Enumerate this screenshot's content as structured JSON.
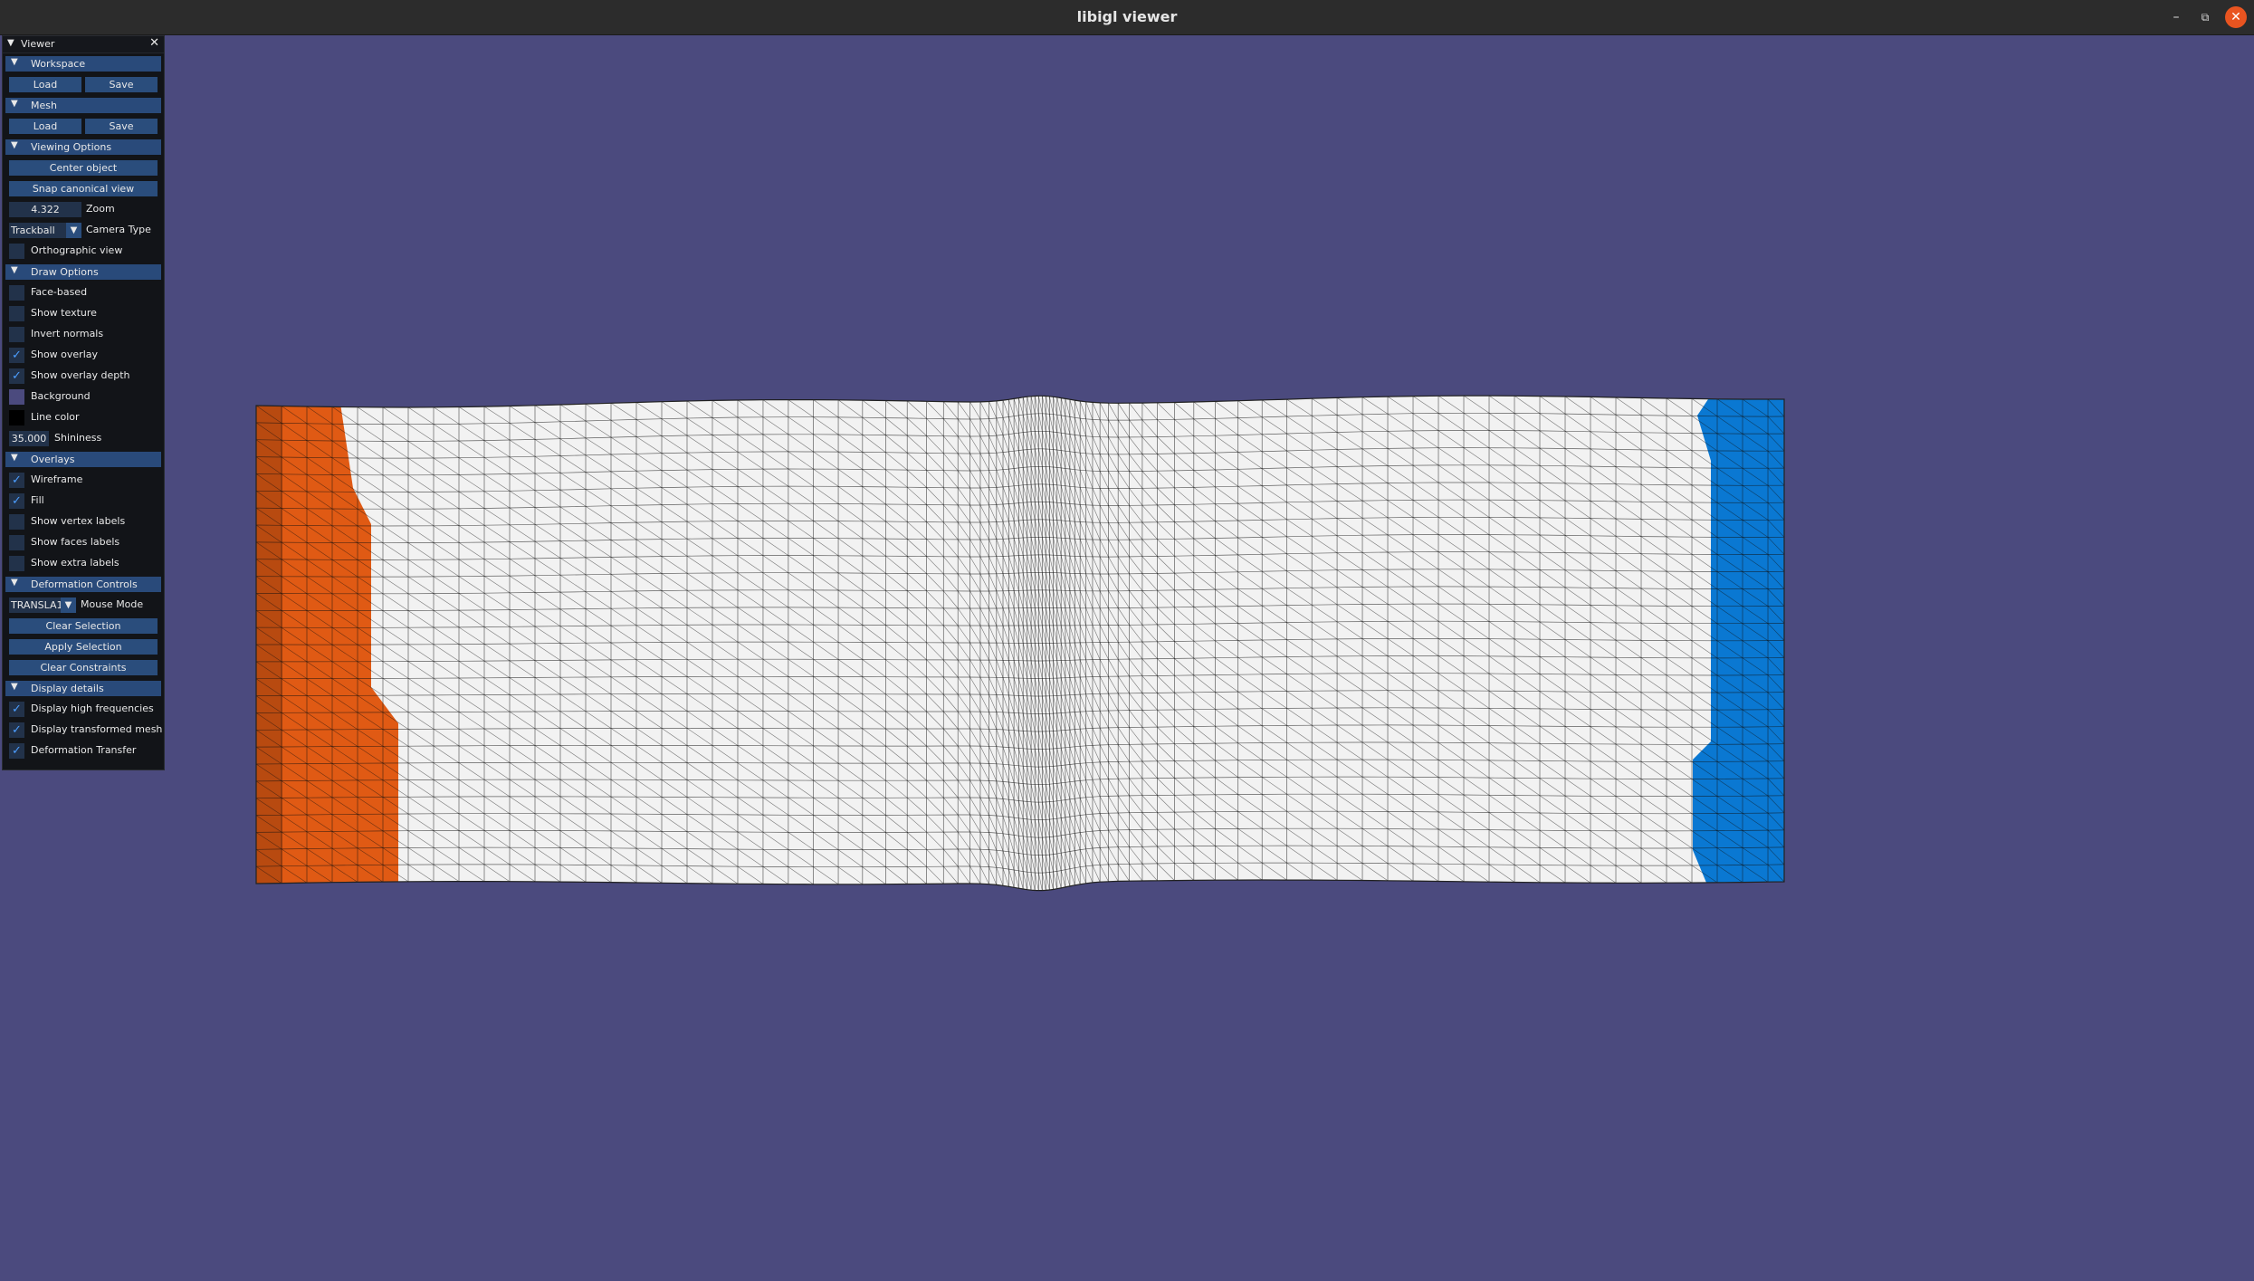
{
  "window": {
    "title": "libigl viewer",
    "minimize_glyph": "–",
    "maximize_glyph": "⧉",
    "close_glyph": "✕"
  },
  "panel": {
    "title": "Viewer",
    "close_glyph": "✕",
    "collapse_glyph": "▼",
    "workspace": {
      "label": "Workspace",
      "load": "Load",
      "save": "Save"
    },
    "mesh": {
      "label": "Mesh",
      "load": "Load",
      "save": "Save"
    },
    "viewing_options": {
      "label": "Viewing Options",
      "center_object": "Center object",
      "snap_canonical_view": "Snap canonical view",
      "zoom_value": "4.322",
      "zoom_label": "Zoom",
      "camera_type_value": "Trackball",
      "camera_type_label": "Camera Type",
      "orthographic_view": {
        "label": "Orthographic view",
        "checked": false
      }
    },
    "draw_options": {
      "label": "Draw Options",
      "face_based": {
        "label": "Face-based",
        "checked": false
      },
      "show_texture": {
        "label": "Show texture",
        "checked": false
      },
      "invert_normals": {
        "label": "Invert normals",
        "checked": false
      },
      "show_overlay": {
        "label": "Show overlay",
        "checked": true
      },
      "show_overlay_depth": {
        "label": "Show overlay depth",
        "checked": true
      },
      "background": {
        "label": "Background",
        "color": "#4b4a7e"
      },
      "line_color": {
        "label": "Line color",
        "color": "#000000"
      },
      "shininess_value": "35.000",
      "shininess_label": "Shininess"
    },
    "overlays": {
      "label": "Overlays",
      "wireframe": {
        "label": "Wireframe",
        "checked": true
      },
      "fill": {
        "label": "Fill",
        "checked": true
      },
      "show_vertex_labels": {
        "label": "Show vertex labels",
        "checked": false
      },
      "show_faces_labels": {
        "label": "Show faces labels",
        "checked": false
      },
      "show_extra_labels": {
        "label": "Show extra labels",
        "checked": false
      }
    },
    "deformation_controls": {
      "label": "Deformation Controls",
      "mouse_mode_value": "TRANSLA1",
      "mouse_mode_label": "Mouse Mode",
      "clear_selection": "Clear Selection",
      "apply_selection": "Apply Selection",
      "clear_constraints": "Clear Constraints"
    },
    "display_details": {
      "label": "Display details",
      "display_high_frequencies": {
        "label": "Display high frequencies",
        "checked": true
      },
      "display_transformed_mesh": {
        "label": "Display transformed mesh",
        "checked": true
      },
      "deformation_transfer": {
        "label": "Deformation Transfer",
        "checked": true
      }
    }
  },
  "colors": {
    "background": "#4b4a7e",
    "mesh_fill": "#f2f2f2",
    "handle_left": "#e05a14",
    "handle_right": "#0a78d2",
    "wire": "#111111"
  },
  "check_glyph": "✓"
}
